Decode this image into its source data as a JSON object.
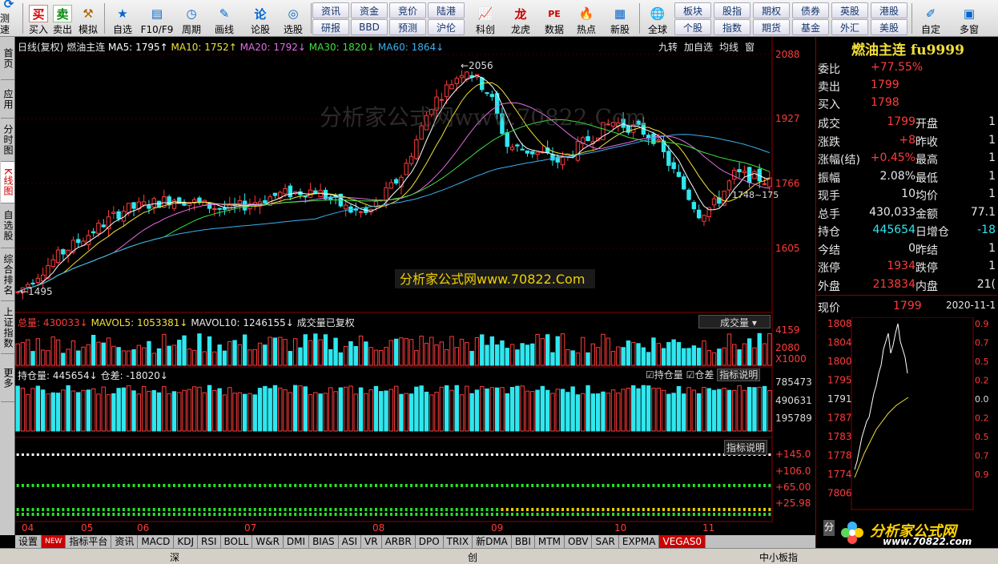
{
  "toolbar": {
    "buttons": [
      {
        "label": "测速",
        "icon": "speed-icon"
      },
      {
        "label": "买入",
        "icon": "buy-icon"
      },
      {
        "label": "卖出",
        "icon": "sell-icon"
      },
      {
        "label": "模拟",
        "icon": "simulate-icon"
      },
      {
        "label": "自选",
        "icon": "star-icon"
      },
      {
        "label": "F10/F9",
        "icon": "f10-icon"
      },
      {
        "label": "周期",
        "icon": "clock-icon"
      },
      {
        "label": "画线",
        "icon": "pen-icon"
      },
      {
        "label": "论股",
        "icon": "discuss-icon"
      },
      {
        "label": "选股",
        "icon": "stockpick-icon"
      },
      {
        "label": "科创",
        "icon": "chart-icon"
      },
      {
        "label": "龙虎",
        "icon": "dragon-icon"
      },
      {
        "label": "数据",
        "icon": "pe-icon"
      },
      {
        "label": "热点",
        "icon": "hot-icon"
      },
      {
        "label": "新股",
        "icon": "ipo-icon"
      },
      {
        "label": "全球",
        "icon": "globe-icon"
      },
      {
        "label": "自定",
        "icon": "custom-icon"
      },
      {
        "label": "多窗",
        "icon": "multiwindow-icon"
      }
    ],
    "quick_row1": [
      "资讯",
      "资金",
      "竞价",
      "陆港"
    ],
    "quick_row2": [
      "研报",
      "BBD",
      "预测",
      "沪伦"
    ],
    "quick2_row1": [
      "板块",
      "股指",
      "期权",
      "债券",
      "英股",
      "港股"
    ],
    "quick2_row2": [
      "个股",
      "指数",
      "期货",
      "基金",
      "外汇",
      "美股"
    ],
    "buy_char": "买",
    "sell_char": "卖"
  },
  "sidebar": {
    "tabs": [
      "首页",
      "应用",
      "分时图",
      "K线图",
      "自选股",
      "综合排名",
      "上证指数",
      "更多"
    ]
  },
  "kline_header": {
    "period": "日线(复权)",
    "name": "燃油主连",
    "ma5": "MA5: 1795↑",
    "ma10": "MA10: 1752↑",
    "ma20": "MA20: 1792↓",
    "ma30": "MA30: 1820↓",
    "ma60": "MA60: 1864↓"
  },
  "kline_tools": [
    "九转",
    "加自选",
    "均线",
    "窗"
  ],
  "price_axis": [
    "2088",
    "1927",
    "1766",
    "1605"
  ],
  "annotations": {
    "high": "2056",
    "low": "1495",
    "cursor": "1748~175"
  },
  "watermark": "分析家公式网www.70822.Com",
  "volume": {
    "title": "总量: 430033↓",
    "mavol5": "MAVOL5: 1053381↓",
    "mavol10": "MAVOL10: 1246155↓",
    "note": "成交量已复权",
    "selector": "成交量",
    "axis": [
      "4159",
      "2080",
      "X1000"
    ]
  },
  "oi": {
    "title": "持仓量: 445654↓",
    "diff": "仓差: -18020↓",
    "check1": "持仓量",
    "check2": "仓差",
    "help": "指标说明",
    "axis": [
      "785473",
      "490631",
      "195789"
    ]
  },
  "indicator": {
    "help": "指标说明",
    "axis": [
      "+145.0",
      "+106.0",
      "+65.00",
      "+25.98"
    ]
  },
  "months": [
    "04",
    "05",
    "06",
    "07",
    "08",
    "09",
    "10",
    "11"
  ],
  "bottom_tabs": [
    "设置",
    "指标平台",
    "资讯",
    "MACD",
    "KDJ",
    "RSI",
    "BOLL",
    "W&R",
    "DMI",
    "BIAS",
    "ASI",
    "VR",
    "ARBR",
    "DPO",
    "TRIX",
    "新DMA",
    "BBI",
    "MTM",
    "OBV",
    "SAR",
    "EXPMA",
    "VEGAS0"
  ],
  "new_badge": "NEW",
  "right_panel": {
    "title": "燃油主连 fu9999",
    "rows": [
      {
        "k": "委比",
        "v": "+77.55%"
      },
      {
        "k": "卖出",
        "v": "1799"
      },
      {
        "k": "买入",
        "v": "1798"
      }
    ],
    "grid": [
      [
        "成交",
        "1799",
        "开盘",
        "1"
      ],
      [
        "涨跌",
        "+8",
        "昨收",
        "1"
      ],
      [
        "涨幅(结)",
        "+0.45%",
        "最高",
        "1"
      ],
      [
        "振幅",
        "2.08%",
        "最低",
        "1"
      ],
      [
        "现手",
        "10",
        "均价",
        "1"
      ],
      [
        "总手",
        "430,033",
        "金额",
        "77.1"
      ],
      [
        "持仓",
        "445654",
        "日增仓",
        "-18"
      ],
      [
        "今结",
        "0",
        "昨结",
        "1"
      ],
      [
        "涨停",
        "1934",
        "跌停",
        "1"
      ],
      [
        "外盘",
        "213834",
        "内盘",
        "21("
      ]
    ],
    "now_label": "现价",
    "now_value": "1799",
    "date": "2020-11-1",
    "mini_axis": [
      "1808",
      "1804",
      "1800",
      "1795",
      "1791",
      "1787",
      "1783",
      "1778",
      "1774",
      "7806"
    ],
    "mini_pct": [
      "0.9",
      "0.7",
      "0.5",
      "0.2",
      "0.0",
      "0.2",
      "0.5",
      "0.7",
      "0.9"
    ],
    "tab": "分"
  },
  "logo": {
    "text": "分析家公式网",
    "url": "www.70822.com"
  },
  "status": {
    "left": "深",
    "mid": "创",
    "right": "中小板指"
  },
  "colors": {
    "up": "#ff3b3b",
    "down": "#2fe7ef",
    "bg": "#000000"
  }
}
